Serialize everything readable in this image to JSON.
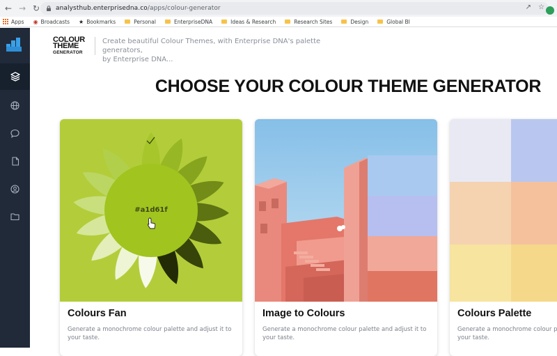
{
  "browser": {
    "url_host": "analysthub.enterprisedna.co",
    "url_path": "/apps/colour-generator",
    "bookmarks": [
      {
        "label": "Apps",
        "icon": "apps-grid-icon"
      },
      {
        "label": "Broadcasts",
        "icon": "broadcast-icon"
      },
      {
        "label": "Bookmarks",
        "icon": "star-icon"
      },
      {
        "label": "Personal",
        "icon": "folder-icon"
      },
      {
        "label": "EnterpriseDNA",
        "icon": "folder-icon"
      },
      {
        "label": "Ideas & Research",
        "icon": "folder-icon"
      },
      {
        "label": "Research Sites",
        "icon": "folder-icon"
      },
      {
        "label": "Design",
        "icon": "folder-icon"
      },
      {
        "label": "Global BI",
        "icon": "folder-icon"
      }
    ]
  },
  "sidebar": {
    "items": [
      {
        "icon": "layers-icon",
        "active": true
      },
      {
        "icon": "globe-icon",
        "active": false
      },
      {
        "icon": "chat-icon",
        "active": false
      },
      {
        "icon": "document-icon",
        "active": false
      },
      {
        "icon": "user-circle-icon",
        "active": false
      },
      {
        "icon": "folder-icon",
        "active": false
      }
    ]
  },
  "header": {
    "brand_line1": "COLOUR",
    "brand_line2": "THEME",
    "brand_line3": "GENERATOR",
    "tagline_line1": "Create beautiful Colour Themes, with Enterprise DNA's palette generators,",
    "tagline_line2": "by Enterprise DNA..."
  },
  "main": {
    "heading": "CHOOSE YOUR COLOUR THEME GENERATOR",
    "cards": [
      {
        "title": "Colours Fan",
        "desc_line1": "Generate a monochrome colour palette and adjust it to",
        "desc_line2": "your taste.",
        "hex": "#a1d61f"
      },
      {
        "title": "Image to Colours",
        "desc_line1": "Generate a monochrome colour palette and adjust it to",
        "desc_line2": "your taste."
      },
      {
        "title": "Colours Palette",
        "desc_line1": "Generate a monochrome colour palette and adjust it to",
        "desc_line2": "your taste."
      }
    ]
  },
  "colors": {
    "rail": "#202a39",
    "accent_green": "#a1d61f",
    "fan_bg": "#b3cd3a"
  }
}
